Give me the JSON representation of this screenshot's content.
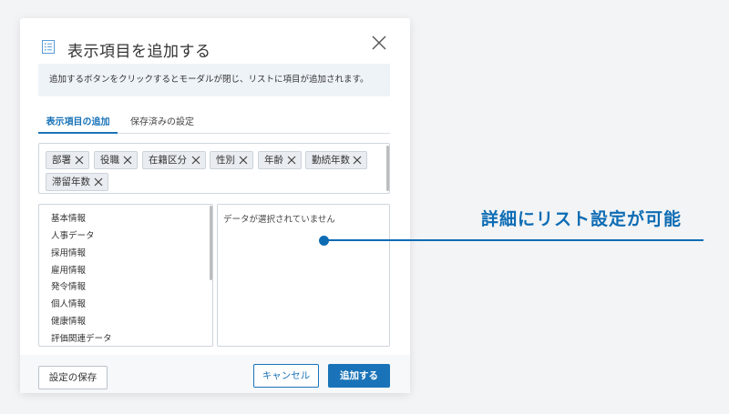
{
  "modal": {
    "title": "表示項目を追加する",
    "info": "追加するボタンをクリックするとモーダルが閉じ、リストに項目が追加されます。"
  },
  "tabs": [
    {
      "label": "表示項目の追加",
      "active": true
    },
    {
      "label": "保存済みの設定",
      "active": false
    }
  ],
  "chips": [
    "部署",
    "役職",
    "在籍区分",
    "性別",
    "年齢",
    "勤続年数",
    "滞留年数"
  ],
  "categories": [
    "基本情報",
    "人事データ",
    "採用情報",
    "雇用情報",
    "発令情報",
    "個人情報",
    "健康情報",
    "評価関連データ"
  ],
  "detail": {
    "empty_text": "データが選択されていません"
  },
  "footer": {
    "save_label": "設定の保存",
    "cancel_label": "キャンセル",
    "add_label": "追加する"
  },
  "callout": {
    "text": "詳細にリスト設定が可能"
  },
  "colors": {
    "accent": "#1a73b8",
    "callout": "#0d6cb4"
  }
}
